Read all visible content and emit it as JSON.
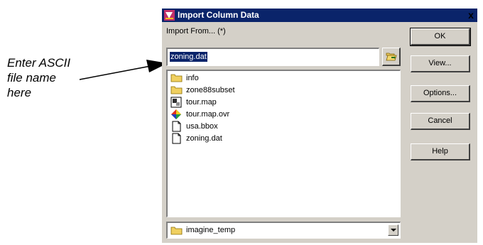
{
  "callout": {
    "line1": "Enter ASCII",
    "line2": "file name",
    "line3": "here"
  },
  "dialog": {
    "title": "Import Column Data",
    "close_glyph": "x",
    "import_from_label": "Import From... (*)",
    "filename_value": "zoning.dat",
    "browse_icon": "folder-open-icon",
    "files": [
      {
        "name": "info",
        "icon": "folder-icon"
      },
      {
        "name": "zone88subset",
        "icon": "folder-icon"
      },
      {
        "name": "tour.map",
        "icon": "map-file-icon"
      },
      {
        "name": "tour.map.ovr",
        "icon": "overlay-file-icon"
      },
      {
        "name": "usa.bbox",
        "icon": "file-icon"
      },
      {
        "name": "zoning.dat",
        "icon": "file-icon"
      }
    ],
    "directory": "imagine_temp",
    "buttons": {
      "ok": "OK",
      "view": "View...",
      "options": "Options...",
      "cancel": "Cancel",
      "help": "Help"
    }
  },
  "colors": {
    "titlebar": "#0a246a",
    "dialog_bg": "#d4d0c8",
    "selection": "#0a246a"
  }
}
